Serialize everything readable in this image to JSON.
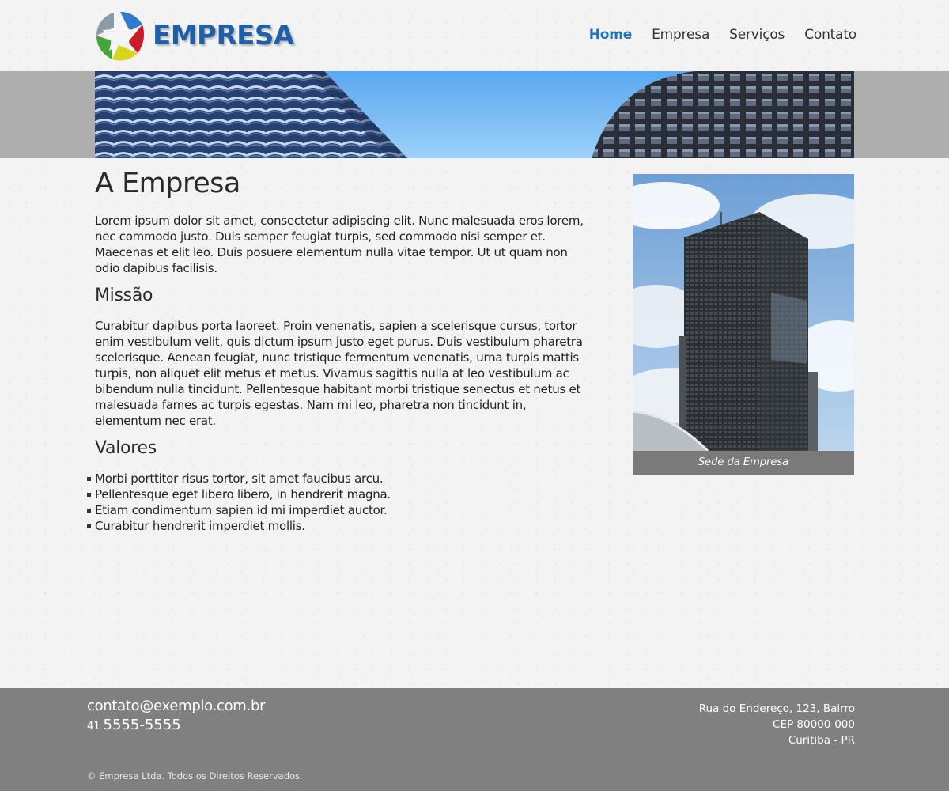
{
  "header": {
    "logo_text": "EMPRESA",
    "nav": [
      {
        "label": "Home",
        "active": true
      },
      {
        "label": "Empresa",
        "active": false
      },
      {
        "label": "Serviços",
        "active": false
      },
      {
        "label": "Contato",
        "active": false
      }
    ]
  },
  "main": {
    "title": "A Empresa",
    "intro": "Lorem ipsum dolor sit amet, consectetur adipiscing elit. Nunc malesuada eros lorem, nec commodo justo. Duis semper feugiat turpis, sed commodo nisi semper et. Maecenas et elit leo. Duis posuere elementum nulla vitae tempor. Ut ut quam non odio dapibus facilisis.",
    "missao_title": "Missão",
    "missao_text": "Curabitur dapibus porta laoreet. Proin venenatis, sapien a scelerisque cursus, tortor enim vestibulum velit, quis dictum ipsum justo eget purus. Duis vestibulum pharetra scelerisque. Aenean feugiat, nunc tristique fermentum venenatis, urna turpis mattis turpis, non aliquet elit metus et metus. Vivamus sagittis nulla at leo vestibulum ac bibendum nulla tincidunt. Pellentesque habitant morbi tristique senectus et netus et malesuada fames ac turpis egestas. Nam mi leo, pharetra non tincidunt in, elementum nec erat.",
    "valores_title": "Valores",
    "valores": [
      "Morbi porttitor risus tortor, sit amet faucibus arcu.",
      "Pellentesque eget libero libero, in hendrerit magna.",
      "Etiam condimentum sapien id mi imperdiet auctor.",
      "Curabitur hendrerit imperdiet mollis."
    ]
  },
  "figure": {
    "caption": "Sede da Empresa"
  },
  "footer": {
    "email": "contato@exemplo.com.br",
    "phone_ddd": "41",
    "phone_number": "5555-5555",
    "address_line1": "Rua do Endereço, 123, Bairro",
    "address_line2": "CEP 80000-000",
    "address_line3": "Curitiba - PR",
    "copyright": "© Empresa Ltda. Todos os Direitos Reservados."
  },
  "colors": {
    "brand_blue": "#1f5fa8",
    "nav_active": "#1f72c2",
    "footer_bg": "#808080",
    "banner_strip": "#aeaeae"
  }
}
